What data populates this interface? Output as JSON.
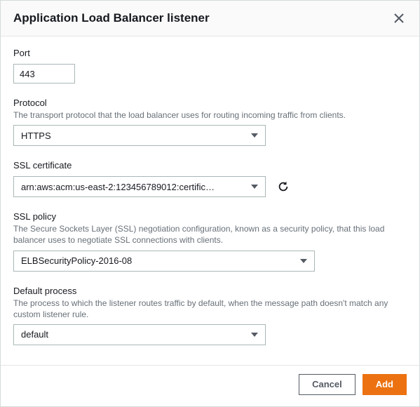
{
  "header": {
    "title": "Application Load Balancer listener"
  },
  "fields": {
    "port": {
      "label": "Port",
      "value": "443"
    },
    "protocol": {
      "label": "Protocol",
      "help": "The transport protocol that the load balancer uses for routing incoming traffic from clients.",
      "value": "HTTPS"
    },
    "ssl_certificate": {
      "label": "SSL certificate",
      "value": "arn:aws:acm:us-east-2:123456789012:certific…"
    },
    "ssl_policy": {
      "label": "SSL policy",
      "help": "The Secure Sockets Layer (SSL) negotiation configuration, known as a security policy, that this load balancer uses to negotiate SSL connections with clients.",
      "value": "ELBSecurityPolicy-2016-08"
    },
    "default_process": {
      "label": "Default process",
      "help": "The process to which the listener routes traffic by default, when the message path doesn't match any custom listener rule.",
      "value": "default"
    }
  },
  "footer": {
    "cancel": "Cancel",
    "add": "Add"
  }
}
